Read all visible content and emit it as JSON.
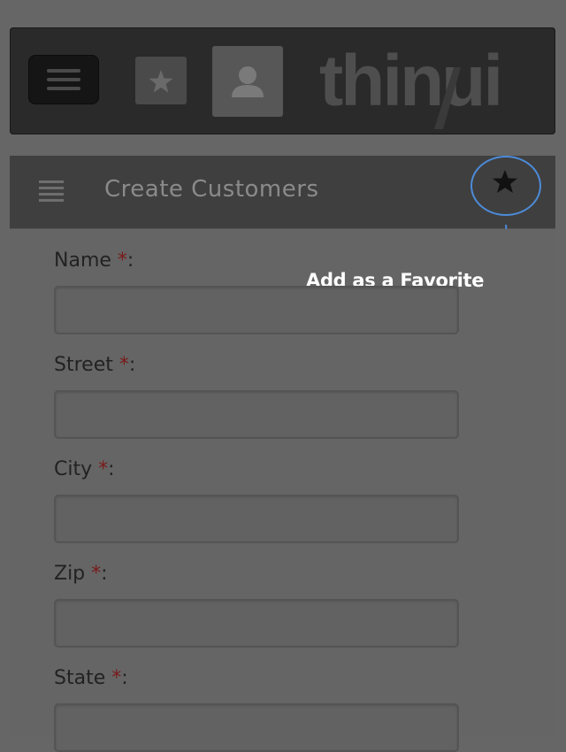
{
  "header": {
    "menu_icon": "hamburger-icon",
    "favorites_icon": "star-icon",
    "user_icon": "user-icon",
    "logo_text": "thinui"
  },
  "panel": {
    "list_icon": "list-icon",
    "title": "Create Customers",
    "favorite_icon": "star-icon"
  },
  "annotation": {
    "text": "Add as a Favorite",
    "color": "#4d8bd8"
  },
  "form": {
    "required_marker": "*",
    "fields": [
      {
        "label": "Name",
        "suffix": ":",
        "value": ""
      },
      {
        "label": "Street",
        "suffix": ":",
        "value": ""
      },
      {
        "label": "City",
        "suffix": ":",
        "value": ""
      },
      {
        "label": "Zip",
        "suffix": ":",
        "value": ""
      },
      {
        "label": "State",
        "suffix": ":",
        "value": ""
      }
    ]
  }
}
